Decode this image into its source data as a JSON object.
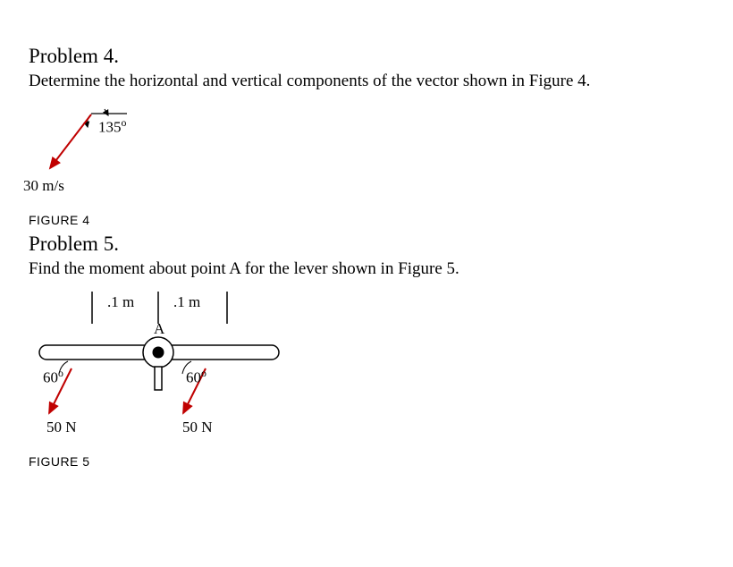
{
  "problem4": {
    "title": "Problem 4.",
    "text": "Determine the horizontal and vertical components of the vector shown in Figure 4.",
    "figure_caption": "FIGURE 4",
    "angle_label": "135",
    "angle_unit": "o",
    "magnitude": "30 m/s"
  },
  "problem5": {
    "title": "Problem 5.",
    "text": "Find the moment about point A for the lever shown in Figure 5.",
    "figure_caption": "FIGURE 5",
    "dist_left": ".1 m",
    "dist_right": ".1 m",
    "point_label": "A",
    "angle_left": "60",
    "angle_right": "60",
    "angle_unit": "o",
    "force_left": "50 N",
    "force_right": "50 N"
  }
}
